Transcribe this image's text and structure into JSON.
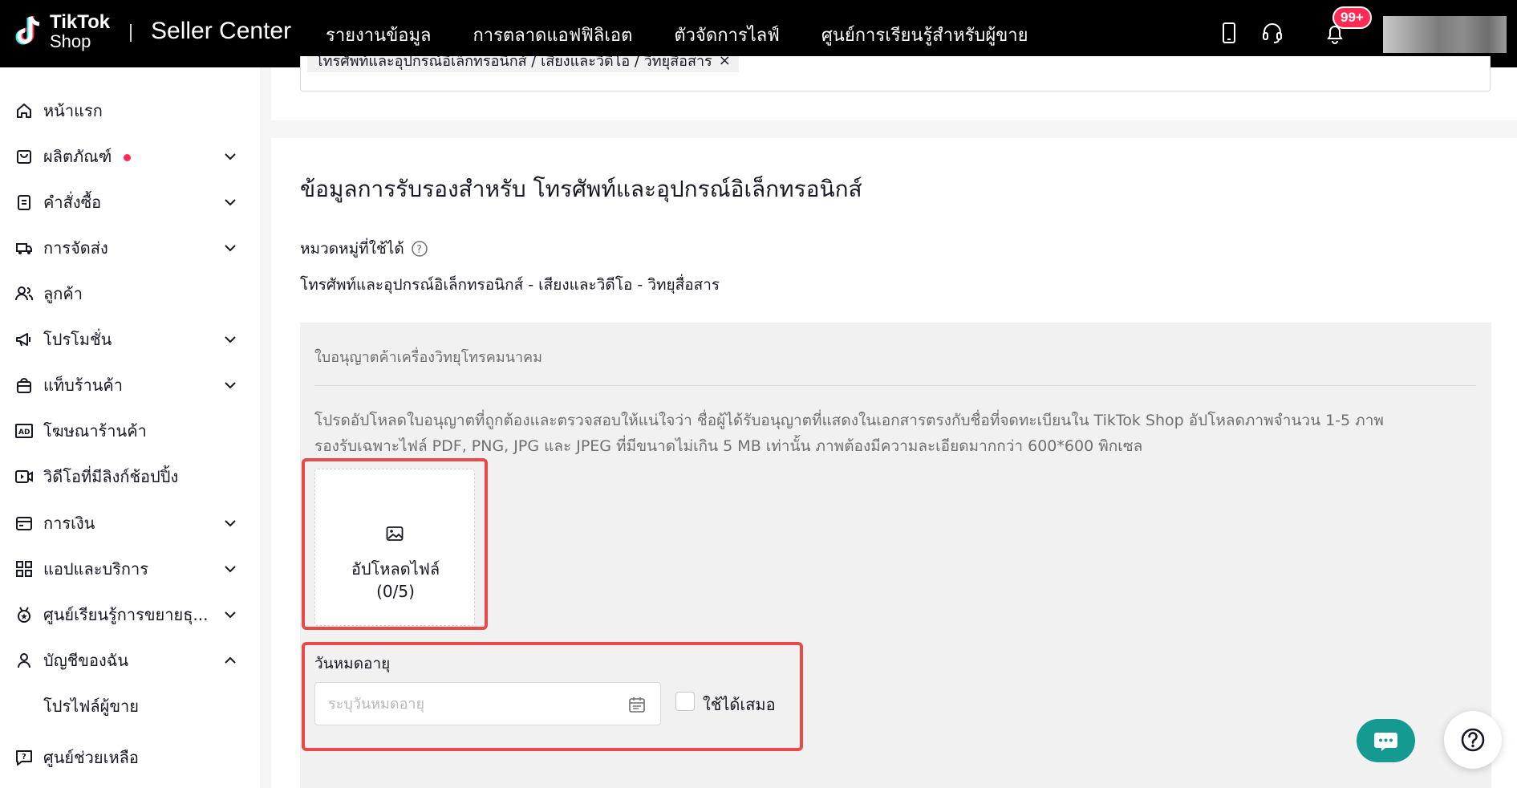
{
  "topbar": {
    "logo_line1": "TikTok",
    "logo_line2": "Shop",
    "brand": "Seller Center",
    "nav": [
      "รายงานข้อมูล",
      "การตลาดแอฟฟิลิเอต",
      "ตัวจัดการไลฟ์",
      "ศูนย์การเรียนรู้สำหรับผู้ขาย"
    ],
    "notification_badge": "99+",
    "icons": [
      "phone-icon",
      "headset-icon",
      "bell-icon"
    ]
  },
  "sidebar": {
    "items": [
      {
        "label": "หน้าแรก",
        "icon": "home-icon"
      },
      {
        "label": "ผลิตภัณฑ์",
        "icon": "bag-icon"
      },
      {
        "label": "คำสั่งซื้อ",
        "icon": "clipboard-icon"
      },
      {
        "label": "การจัดส่ง",
        "icon": "truck-icon"
      },
      {
        "label": "ลูกค้า",
        "icon": "users-icon"
      },
      {
        "label": "โปรโมชั่น",
        "icon": "megaphone-icon"
      },
      {
        "label": "แท็บร้านค้า",
        "icon": "store-bag-icon"
      },
      {
        "label": "โฆษณาร้านค้า",
        "icon": "ad-icon"
      },
      {
        "label": "วิดีโอที่มีลิงก์ช้อปปิ้ง",
        "icon": "video-icon"
      },
      {
        "label": "การเงิน",
        "icon": "wallet-icon"
      },
      {
        "label": "แอปและบริการ",
        "icon": "apps-icon"
      },
      {
        "label": "ศูนย์เรียนรู้การขยายธุ...",
        "icon": "medal-icon"
      },
      {
        "label": "บัญชีของฉัน",
        "icon": "user-icon"
      }
    ],
    "sub_item": "โปรไฟล์ผู้ขาย",
    "help": {
      "label": "ศูนย์ช่วยเหลือ",
      "icon": "help-chat-icon"
    }
  },
  "category_select": {
    "tag": "โทรศัพท์และอุปกรณ์อิเล็กทรอนิกส์ / เสียงและวิดีโอ / วิทยุสื่อสาร",
    "tag_close": "×"
  },
  "section": {
    "title": "ข้อมูลการรับรองสำหรับ โทรศัพท์และอุปกรณ์อิเล็กทรอนิกส์",
    "category_label": "หมวดหมู่ที่ใช้ได้",
    "category_value": "โทรศัพท์และอุปกรณ์อิเล็กทรอนิกส์ - เสียงและวิดีโอ - วิทยุสื่อสาร"
  },
  "license": {
    "title": "ใบอนุญาตค้าเครื่องวิทยุโทรคมนาคม",
    "desc_line1": "โปรดอัปโหลดใบอนุญาตที่ถูกต้องและตรวจสอบให้แน่ใจว่า ชื่อผู้ได้รับอนุญาตที่แสดงในเอกสารตรงกับชื่อที่จดทะเบียนใน TikTok Shop อัปโหลดภาพจำนวน 1-5 ภาพ",
    "desc_line2": "รองรับเฉพาะไฟล์ PDF, PNG, JPG และ JPEG ที่มีขนาดไม่เกิน 5 MB เท่านั้น ภาพต้องมีความละเอียดมากกว่า 600*600 พิกเซล",
    "upload_label": "อัปโหลดไฟล์",
    "upload_count": "(0/5)",
    "expiry_label": "วันหมดอายุ",
    "expiry_placeholder": "ระบุวันหมดอายุ",
    "expiry_value": "",
    "always_valid_label": "ใช้ได้เสมอ",
    "always_valid_checked": false
  },
  "colors": {
    "highlight": "#e84a4a",
    "accent": "#fe2c55",
    "chat_fab": "#159a92"
  }
}
